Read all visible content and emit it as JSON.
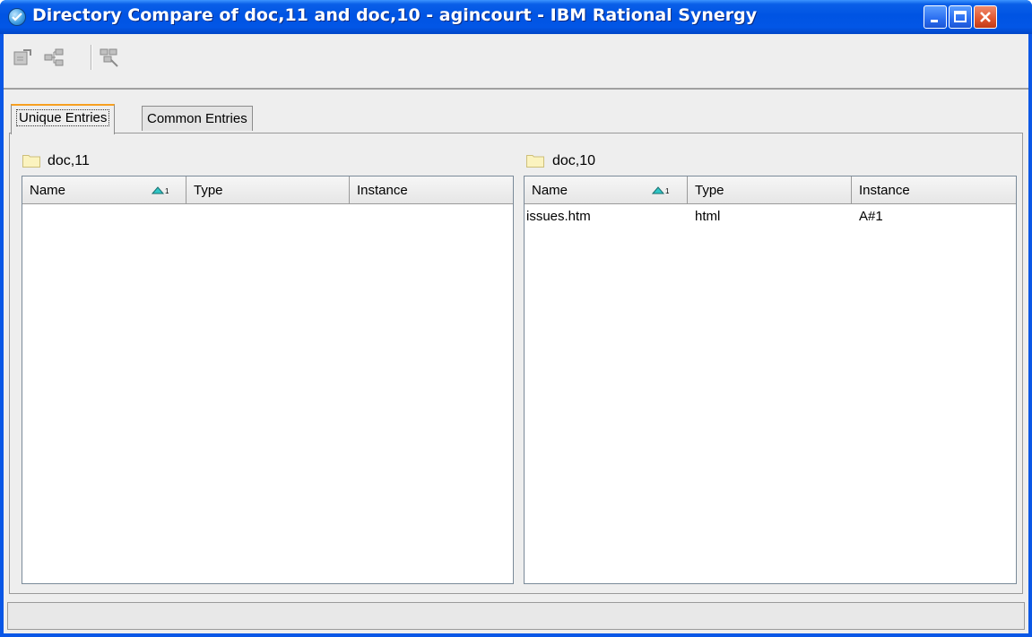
{
  "window": {
    "title": "Directory Compare of doc,11 and doc,10 - agincourt - IBM Rational Synergy"
  },
  "toolbar": {
    "buttons": [
      {
        "icon": "compare-icon"
      },
      {
        "icon": "hierarchy-icon"
      },
      {
        "icon": "find-differences-icon"
      }
    ]
  },
  "tabs": [
    {
      "label": "Unique Entries",
      "active": true
    },
    {
      "label": "Common Entries",
      "active": false
    }
  ],
  "left": {
    "folder": "doc,11",
    "columns": [
      "Name",
      "Type",
      "Instance"
    ],
    "sort_indicator": "1",
    "rows": []
  },
  "right": {
    "folder": "doc,10",
    "columns": [
      "Name",
      "Type",
      "Instance"
    ],
    "sort_indicator": "1",
    "rows": [
      {
        "name": "issues.htm",
        "type": "html",
        "instance": "A#1"
      }
    ]
  },
  "colors": {
    "title_bar": "#0054e3",
    "active_tab_accent": "#f7a020",
    "sort_arrow": "#2fc6c6"
  }
}
